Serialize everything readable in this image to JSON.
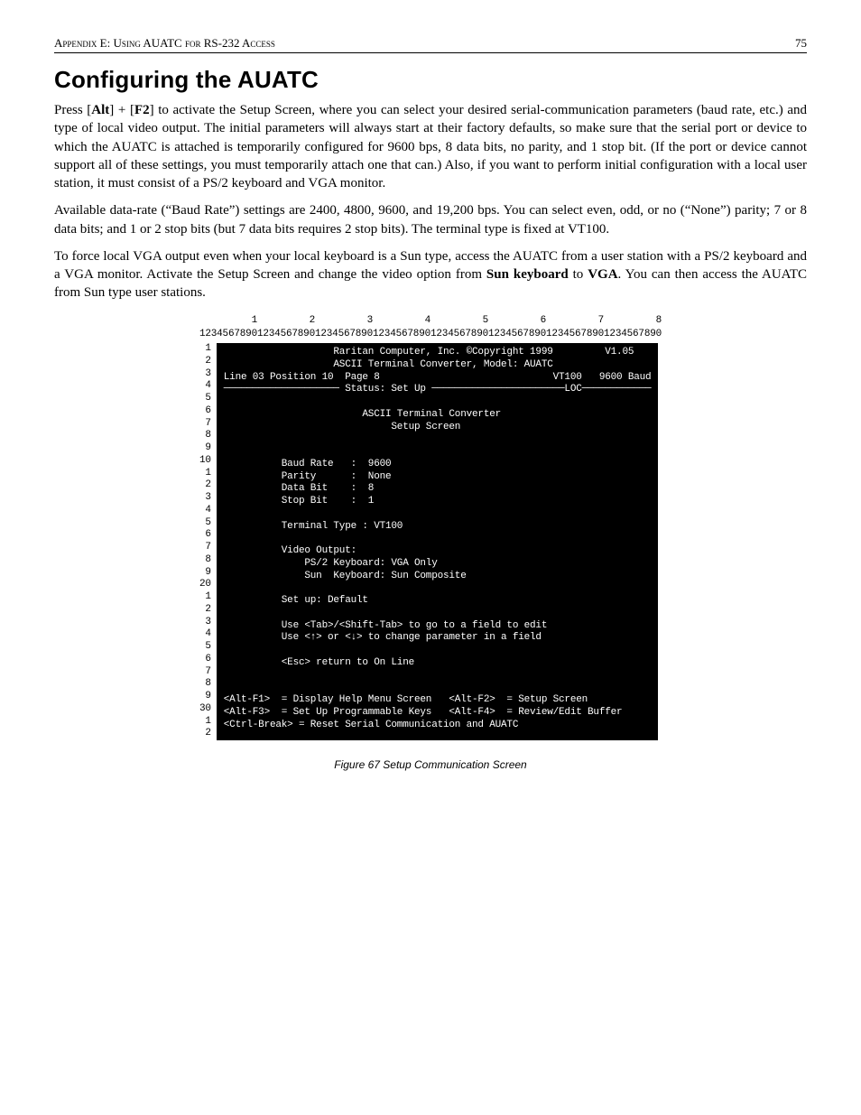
{
  "header": {
    "left": "Appendix E: Using AUATC for RS-232 Access",
    "page": "75"
  },
  "title": "Configuring the AUATC",
  "p1_a": "Press [",
  "p1_b": "Alt",
  "p1_c": "] + [",
  "p1_d": "F2",
  "p1_e": "] to activate the Setup Screen, where you can select your desired serial-communication parameters (baud rate, etc.) and type of local video output. The initial parameters will always start at their factory defaults, so make sure that the serial port or device to which the AUATC is attached is temporarily configured for 9600 bps, 8 data bits, no parity, and 1 stop bit. (If the port or device cannot support all of these settings, you must temporarily attach one that can.) Also, if you want to perform initial configuration with a local user station, it must consist of a PS/2 keyboard and VGA monitor.",
  "p2": "Available data-rate (“Baud Rate”) settings are 2400, 4800, 9600, and 19,200 bps. You can select even, odd, or no (“None”) parity; 7 or 8 data bits; and 1 or 2 stop bits (but 7 data bits requires 2 stop bits). The terminal type is fixed at VT100.",
  "p3_a": "To force local VGA output even when your local keyboard is a Sun type, access the AUATC from a user station with a PS/2 keyboard and a VGA monitor. Activate the Setup Screen and change the video option from ",
  "p3_b": "Sun keyboard",
  "p3_c": " to ",
  "p3_d": "VGA",
  "p3_e": ". You can then access the AUATC from Sun type user stations.",
  "ruler_top": "         1         2         3         4         5         6         7         8",
  "ruler_digits": "12345678901234567890123456789012345678901234567890123456789012345678901234567890",
  "row_labels": " 1\n 2\n 3\n 4\n 5\n 6\n 7\n 8\n 9\n10\n 1\n 2\n 3\n 4\n 5\n 6\n 7\n 8\n 9\n20\n 1\n 2\n 3\n 4\n 5\n 6\n 7\n 8\n 9\n30\n 1\n 2",
  "screen": "                   Raritan Computer, Inc. ©Copyright 1999         V1.05\n                   ASCII Terminal Converter, Model: AUATC\nLine 03 Position 10  Page 8                              VT100   9600 Baud\n──────────────────── Status: Set Up ───────────────────────LOC────────────\n\n                        ASCII Terminal Converter\n                             Setup Screen\n\n\n          Baud Rate   :  9600\n          Parity      :  None\n          Data Bit    :  8\n          Stop Bit    :  1\n\n          Terminal Type : VT100\n\n          Video Output:\n              PS/2 Keyboard: VGA Only\n              Sun  Keyboard: Sun Composite\n\n          Set up: Default\n\n          Use <Tab>/<Shift-Tab> to go to a field to edit\n          Use <↑> or <↓> to change parameter in a field\n\n          <Esc> return to On Line\n\n\n<Alt-F1>  = Display Help Menu Screen   <Alt-F2>  = Setup Screen\n<Alt-F3>  = Set Up Programmable Keys   <Alt-F4>  = Review/Edit Buffer\n<Ctrl-Break> = Reset Serial Communication and AUATC\n",
  "caption": "Figure 67 Setup Communication Screen"
}
